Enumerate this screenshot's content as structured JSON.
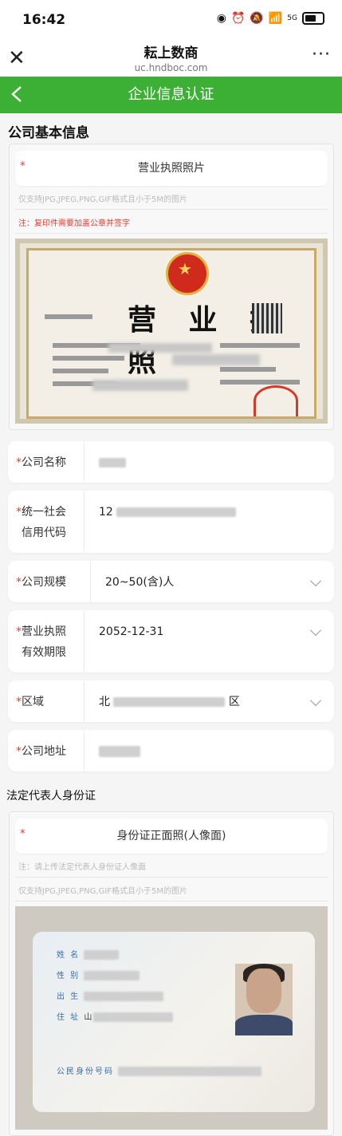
{
  "statusbar": {
    "time": "16:42",
    "signal": "5G"
  },
  "navbar": {
    "close_glyph": "✕",
    "title": "耘上数商",
    "url": "uc.hndboc.com",
    "more_glyph": "···"
  },
  "header": {
    "title": "企业信息认证"
  },
  "company_section": {
    "title": "公司基本信息",
    "license_upload": {
      "label": "营业执照照片",
      "required_mark": "*",
      "hint": "仅支持JPG,JPEG,PNG,GIF格式且小于5M的图片",
      "note": "注：复印件需要加盖公章并签字",
      "image_title": "营 业 执 照"
    }
  },
  "fields": [
    {
      "label_line1": "公司名称",
      "label_line2": "",
      "value": "",
      "dropdown": false
    },
    {
      "label_line1": "统一社会",
      "label_line2": "信用代码",
      "value": "12",
      "dropdown": false
    },
    {
      "label_line1": "公司规模",
      "label_line2": "",
      "value": "20~50(含)人",
      "dropdown": true
    },
    {
      "label_line1": "营业执照",
      "label_line2": "有效期限",
      "value": "2052-12-31",
      "dropdown": true
    },
    {
      "label_line1": "区域",
      "label_line2": "",
      "value": "北",
      "value_suffix": "区",
      "dropdown": true
    },
    {
      "label_line1": "公司地址",
      "label_line2": "",
      "value": "",
      "dropdown": false
    }
  ],
  "legal_section": {
    "title": "法定代表人身份证",
    "id_upload": {
      "label": "身份证正面照(人像面)",
      "required_mark": "*",
      "note1": "注：请上传法定代表人身份证人像面",
      "hint": "仅支持JPG,JPEG,PNG,GIF格式且小于5M的图片"
    },
    "id_card": {
      "name_label": "姓 名",
      "gender_label": "性 别",
      "birth_label": "出 生",
      "address_label": "住 址",
      "address_prefix": "山",
      "id_number_label": "公民身份号码"
    }
  },
  "colors": {
    "accent": "#3cb035",
    "required": "#e8392e"
  }
}
